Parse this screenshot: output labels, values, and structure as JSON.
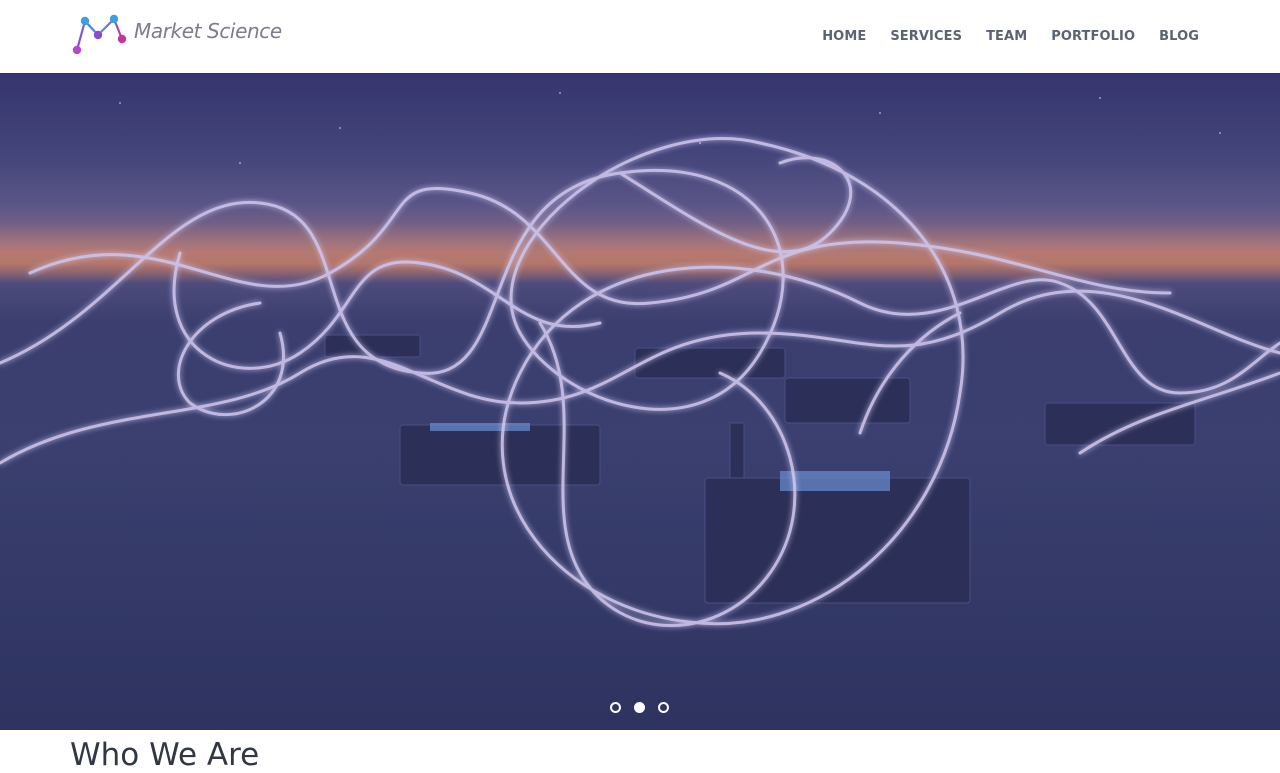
{
  "header": {
    "logo_text": "Market Science",
    "nav": [
      {
        "label": "HOME"
      },
      {
        "label": "SERVICES"
      },
      {
        "label": "TEAM"
      },
      {
        "label": "PORTFOLIO"
      },
      {
        "label": "BLOG"
      }
    ]
  },
  "hero": {
    "active_slide": 2,
    "slide_count": 3
  },
  "section": {
    "heading": "Who We Are"
  },
  "colors": {
    "nav_text": "#5a6373",
    "logo_text": "#7b7d88",
    "logo_dot_blue": "#3aa0e0",
    "logo_dot_magenta": "#c0369c",
    "logo_dot_purple": "#8a4bd0",
    "heading_text": "#323843"
  }
}
